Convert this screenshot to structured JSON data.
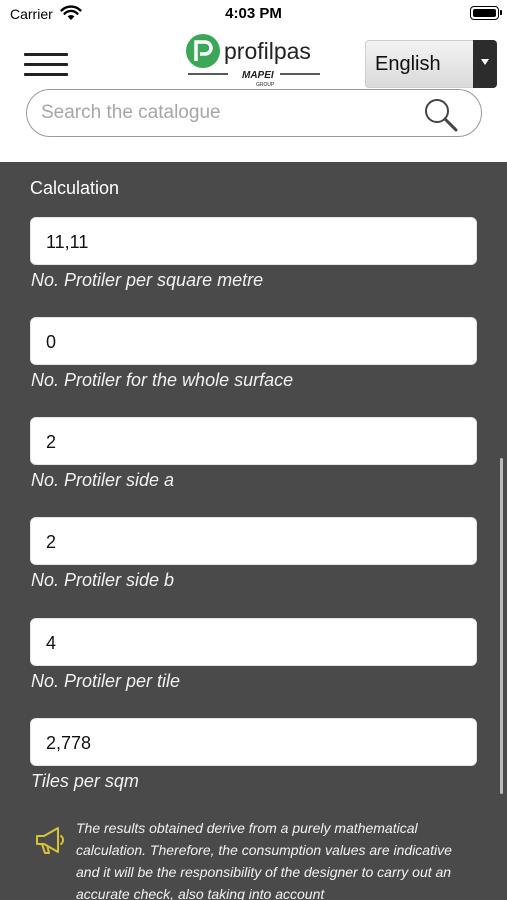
{
  "status_bar": {
    "carrier": "Carrier",
    "time": "4:03 PM"
  },
  "header": {
    "menu_icon": "hamburger-menu-icon",
    "logo": {
      "brand": "profilpas",
      "group": "MAPEI",
      "group_sub": "GROUP"
    },
    "language": {
      "selected": "English"
    }
  },
  "search": {
    "placeholder": "Search the catalogue",
    "icon": "search-icon"
  },
  "calculation": {
    "title": "Calculation",
    "fields": [
      {
        "value": "11,11",
        "label": "No. Protiler per square metre"
      },
      {
        "value": "0",
        "label": "No. Protiler for the whole surface"
      },
      {
        "value": "2",
        "label": "No. Protiler side a"
      },
      {
        "value": "2",
        "label": "No. Protiler side b"
      },
      {
        "value": "4",
        "label": "No. Protiler per tile"
      },
      {
        "value": "2,778",
        "label": "Tiles per sqm"
      }
    ],
    "notice": {
      "icon": "megaphone-icon",
      "text": "The results obtained derive from a purely mathematical calculation. Therefore, the consumption values are indicative and it will be the responsibility of the designer to carry out an accurate check, also taking into account"
    }
  },
  "colors": {
    "content_background": "#4a4a4a",
    "brand_green": "#3aa856",
    "notice_icon": "#d8c23a"
  }
}
